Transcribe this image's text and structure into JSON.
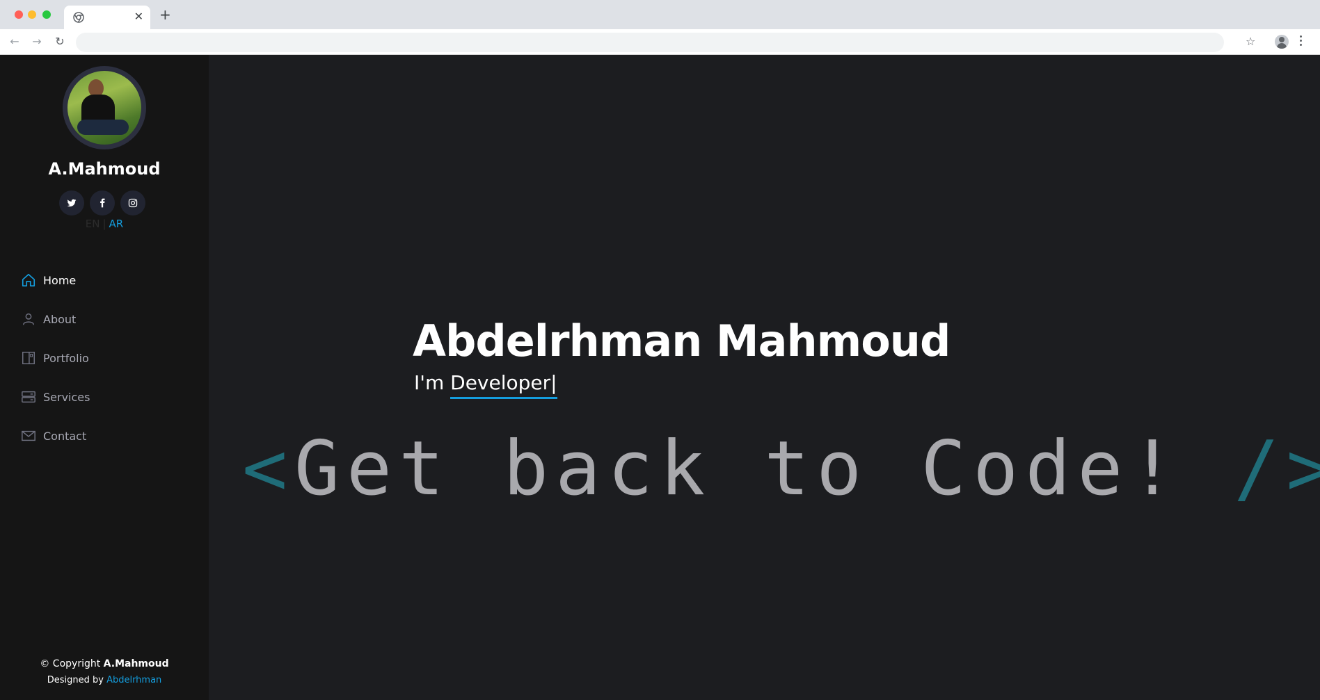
{
  "browser": {
    "tab_title": "",
    "tab_close": "✕",
    "new_tab": "+",
    "address": ""
  },
  "profile": {
    "name": "A.Mahmoud",
    "social": [
      {
        "icon": "twitter-icon",
        "glyph": "🐦"
      },
      {
        "icon": "facebook-icon",
        "glyph": "f"
      },
      {
        "icon": "instagram-icon",
        "glyph": "◎"
      }
    ],
    "lang": {
      "en": "EN",
      "separator": "|",
      "ar": "AR"
    }
  },
  "nav": {
    "items": [
      {
        "label": "Home",
        "icon": "home-icon",
        "active": true
      },
      {
        "label": "About",
        "icon": "person-icon",
        "active": false
      },
      {
        "label": "Portfolio",
        "icon": "portfolio-icon",
        "active": false
      },
      {
        "label": "Services",
        "icon": "server-icon",
        "active": false
      },
      {
        "label": "Contact",
        "icon": "envelope-icon",
        "active": false
      }
    ]
  },
  "footer": {
    "copyright_prefix": "© Copyright ",
    "copyright_brand": "A.Mahmoud",
    "designed_prefix": "Designed by ",
    "designed_link": "Abdelrhman"
  },
  "hero": {
    "name": "Abdelrhman Mahmoud",
    "sub_prefix": "I'm ",
    "typed": "Developer|",
    "code_open": "<",
    "code_text": "Get back to Code! ",
    "code_close": "/>"
  },
  "colors": {
    "accent": "#149ddd",
    "sidebar_bg": "#151515",
    "main_bg": "#1c1d20",
    "bracket": "#1f6c78"
  }
}
